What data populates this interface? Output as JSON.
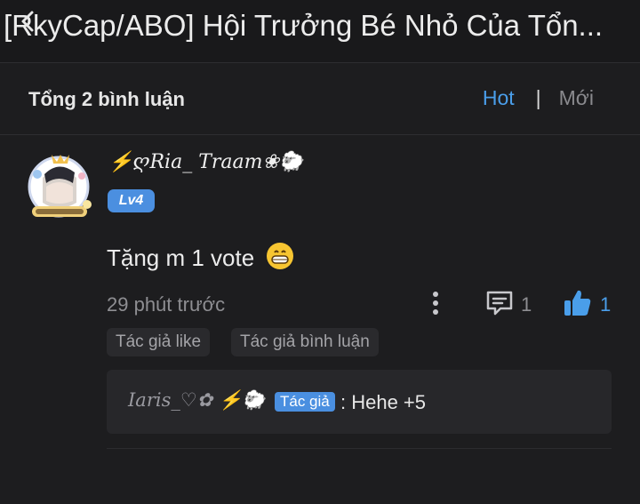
{
  "header": {
    "title": "[RkyCap/ABO] Hội Trưởng Bé Nhỏ Của Tổn..."
  },
  "comments_bar": {
    "total_label": "Tổng 2 bình luận",
    "sort_hot": "Hot",
    "sort_separator": "|",
    "sort_new": "Mới"
  },
  "comment": {
    "username": "⚡ღRia_ Traam❀🐑",
    "level": "Lv4",
    "text": "Tặng m 1 vote",
    "time": "29 phút trước",
    "reply_count": "1",
    "like_count": "1",
    "tags": [
      "Tác giả like",
      "Tác giả bình luận"
    ],
    "reply": {
      "username": "Iaris_♡✿ ⚡🐑",
      "author_badge": "Tác giả",
      "text": ": Hehe +5"
    }
  },
  "colors": {
    "accent": "#4a9eea",
    "background": "#1d1d1f",
    "level_badge": "#4b8fe0"
  },
  "icons": {
    "back": "back-arrow-icon",
    "more": "more-vertical-icon",
    "reply": "comment-bubble-icon",
    "like": "thumbs-up-icon",
    "emoji": "grin-emoji-icon"
  }
}
